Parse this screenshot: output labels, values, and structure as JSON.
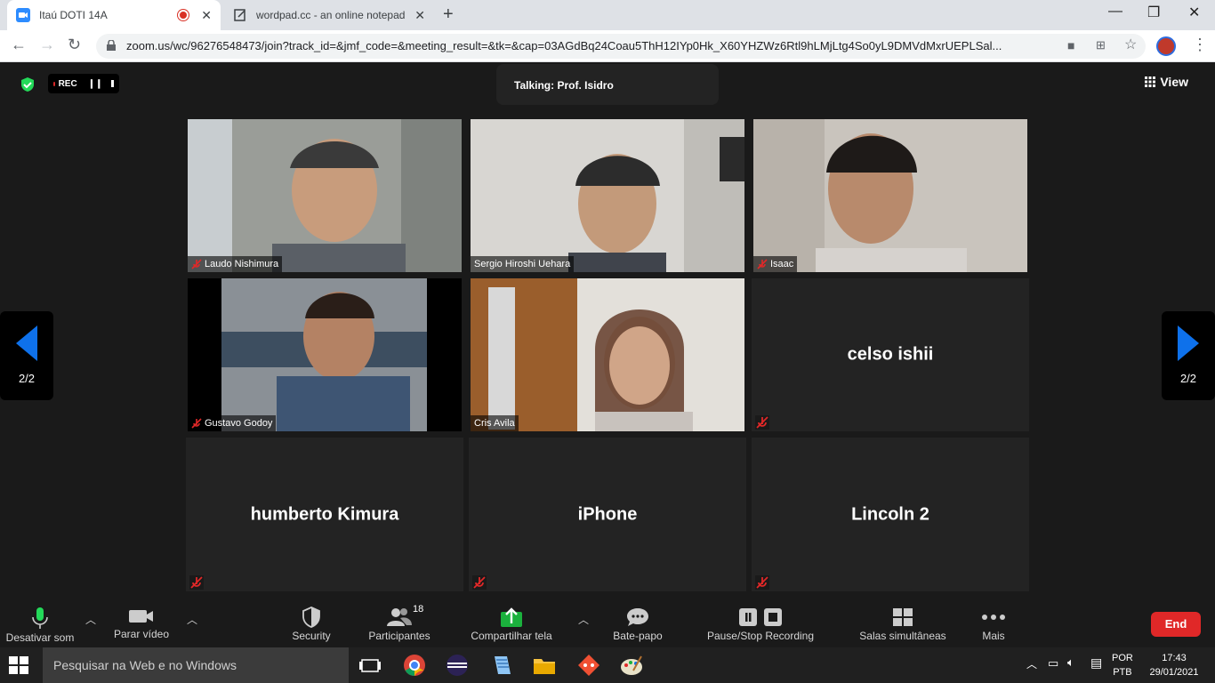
{
  "browser": {
    "tabs": [
      {
        "title": "Itaú DOTI 14A",
        "icon": "zoom-icon"
      },
      {
        "title": "wordpad.cc - an online notepad",
        "icon": "notepad-icon"
      }
    ],
    "url": "zoom.us/wc/96276548473/join?track_id=&jmf_code=&meeting_result=&tk=&cap=03AGdBq24Coau5ThH12IYp0Hk_X60YHZWz6Rtl9hLMjLtg4So0yL9DMVdMxrUEPLSal..."
  },
  "meeting": {
    "rec_label": "REC",
    "talking": "Talking: Prof. Isidro",
    "view_label": "View",
    "page_indicator": "2/2",
    "participants": [
      {
        "name": "Laudo Nishimura",
        "video": true,
        "muted": true
      },
      {
        "name": "Sergio Hiroshi Uehara",
        "video": true,
        "muted": false
      },
      {
        "name": "Isaac",
        "video": true,
        "muted": true
      },
      {
        "name": "Gustavo Godoy",
        "video": true,
        "muted": true
      },
      {
        "name": "Cris Avila",
        "video": true,
        "muted": false
      },
      {
        "name": "celso ishii",
        "video": false,
        "muted": true
      },
      {
        "name": "humberto Kimura",
        "video": false,
        "muted": true
      },
      {
        "name": "iPhone",
        "video": false,
        "muted": true
      },
      {
        "name": "Lincoln 2",
        "video": false,
        "muted": true
      }
    ]
  },
  "toolbar": {
    "mute": "Desativar som",
    "video": "Parar vídeo",
    "security": "Security",
    "participants": "Participantes",
    "participants_count": "18",
    "share": "Compartilhar tela",
    "chat": "Bate-papo",
    "record": "Pause/Stop Recording",
    "breakout": "Salas simultâneas",
    "more": "Mais",
    "end": "End"
  },
  "taskbar": {
    "search_placeholder": "Pesquisar na Web e no Windows",
    "lang1": "POR",
    "lang2": "PTB",
    "time": "17:43",
    "date": "29/01/2021"
  },
  "colors": {
    "accent_blue": "#0e71eb",
    "end_red": "#e02828",
    "share_green": "#1bb13d"
  }
}
